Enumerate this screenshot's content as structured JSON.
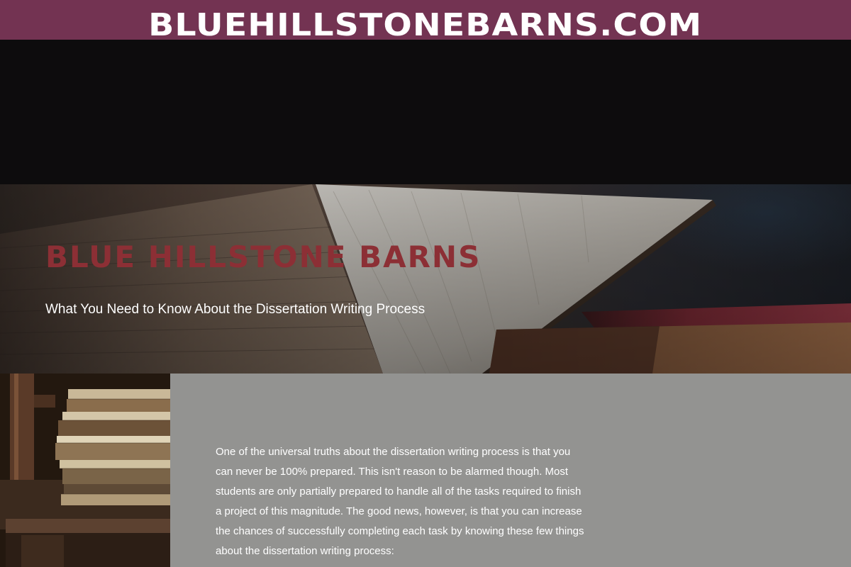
{
  "header": {
    "domain": "BLUEHILLSTONEBARNS.COM"
  },
  "hero": {
    "title": "BLUE HILLSTONE BARNS",
    "subtitle": "What You Need to Know About the Dissertation Writing Process"
  },
  "article": {
    "intro": "One of the universal truths about the dissertation writing process is that you can never be 100% prepared. This isn't reason to be alarmed though. Most students are only partially prepared to handle all of the tasks required to finish a project of this magnitude. The good news, however, is that you can increase the chances of successfully completing each task by knowing these few things about the dissertation writing process:"
  },
  "colors": {
    "banner": "#733352",
    "hero_title": "#8c2f35",
    "content_bg": "#939391",
    "dark_band": "#0d0c0d"
  }
}
